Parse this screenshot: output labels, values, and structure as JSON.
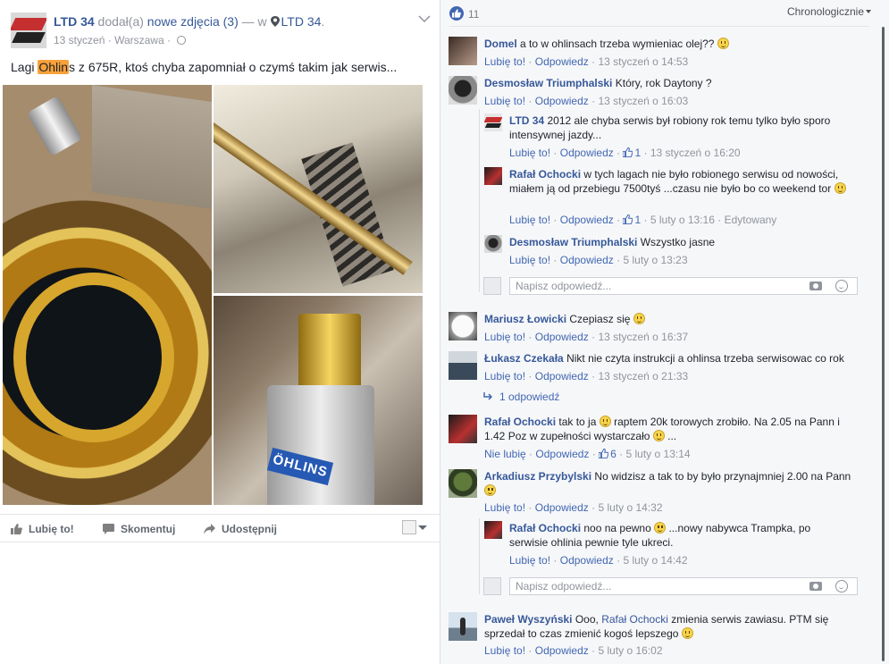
{
  "post": {
    "page_name": "LTD 34",
    "action_text": "dodał(a)",
    "photos_link": "nowe zdjęcia (3)",
    "at_prefix": "— w",
    "location": "LTD 34",
    "location_suffix": ".",
    "date": "13 styczeń",
    "dot": "·",
    "place": "Warszawa",
    "text_before": "Lagi ",
    "text_highlight": "Ohlin",
    "text_after": "s z 675R, ktoś chyba zapomniał o czymś takim jak serwis...",
    "photo_logo": "ÖHLINS",
    "actions": {
      "like": "Lubię to!",
      "comment": "Skomentuj",
      "share": "Udostępnij"
    }
  },
  "comments_panel": {
    "likes_count": "11",
    "sort_label": "Chronologicznie",
    "reply_placeholder": "Napisz odpowiedź...",
    "replies_link": "1 odpowiedź"
  },
  "meta_words": {
    "like": "Lubię to!",
    "unlike": "Nie lubię",
    "reply": "Odpowiedz",
    "dot": "·",
    "edited": "Edytowany"
  },
  "comments": [
    {
      "author": "Domel",
      "text": "a to w ohlinsach trzeba wymieniac olej??",
      "emoji": true,
      "likes": "",
      "time": "13 styczeń o 14:53"
    },
    {
      "author": "Desmosław Triumphalski",
      "text": "Który, rok Daytony ?",
      "emoji": false,
      "likes": "",
      "time": "13 styczeń o 16:03"
    },
    {
      "author": "LTD 34",
      "text": "2012 ale chyba serwis był robiony rok temu tylko było sporo intensywnej jazdy...",
      "emoji": false,
      "likes": "1",
      "time": "13 styczeń o 16:20"
    },
    {
      "author": "Rafał Ochocki",
      "text": "w tych lagach nie było robionego serwisu od nowości, miałem ją od przebiegu 7500tyś ...czasu nie było bo co weekend tor",
      "emoji": true,
      "likes": "1",
      "time": "5 luty o 13:16"
    },
    {
      "author": "Desmosław Triumphalski",
      "text": "Wszystko jasne",
      "emoji": false,
      "likes": "",
      "time": "5 luty o 13:23"
    },
    {
      "author": "Mariusz Łowicki",
      "text": "Czepiasz się",
      "emoji": true,
      "likes": "",
      "time": "13 styczeń o 16:37"
    },
    {
      "author": "Łukasz Czekała",
      "text": "Nikt nie czyta instrukcji a ohlinsa trzeba serwisowac co rok",
      "emoji": false,
      "likes": "",
      "time": "13 styczeń o 21:33"
    },
    {
      "author": "Rafał Ochocki",
      "text_a": "tak to ja",
      "text_b": "raptem 20k torowych zrobiło. Na 2.05 na Pann i 1.42 Poz w zupełności wystarczało",
      "text_c": "...",
      "likes": "6",
      "time": "5 luty o 13:14"
    },
    {
      "author": "Arkadiusz Przybylski",
      "text": "No widzisz a tak to by było przynajmniej 2.00 na Pann",
      "emoji": true,
      "likes": "",
      "time": "5 luty o 14:32"
    },
    {
      "author": "Rafał Ochocki",
      "text_a": "noo na pewno",
      "text_b": "...nowy nabywca Trampka, po serwisie ohlinia pewnie tyle ukreci.",
      "likes": "",
      "time": "5 luty o 14:42"
    },
    {
      "author": "Paweł Wyszyński",
      "text_a": "Ooo,",
      "mention": "Rafał Ochocki",
      "text_b": "zmienia serwis zawiasu. PTM się sprzedał to czas zmienić kogoś lepszego",
      "likes": "",
      "time": "5 luty o 16:02"
    }
  ],
  "colors": {
    "link_blue": "#365899",
    "action_blue": "#4267b2",
    "meta_grey": "#90949c",
    "panel_bg": "#f6f7f9",
    "highlight": "#f7a13b"
  },
  "icons": {
    "likes": "thumbs-up-icon",
    "location": "map-pin-icon",
    "privacy": "globe-icon",
    "menu": "chevron-down-icon",
    "comment": "speech-bubble-icon",
    "share": "share-arrow-icon",
    "camera": "camera-icon",
    "emoji": "smiley-icon",
    "replies": "reply-arrow-icon"
  }
}
